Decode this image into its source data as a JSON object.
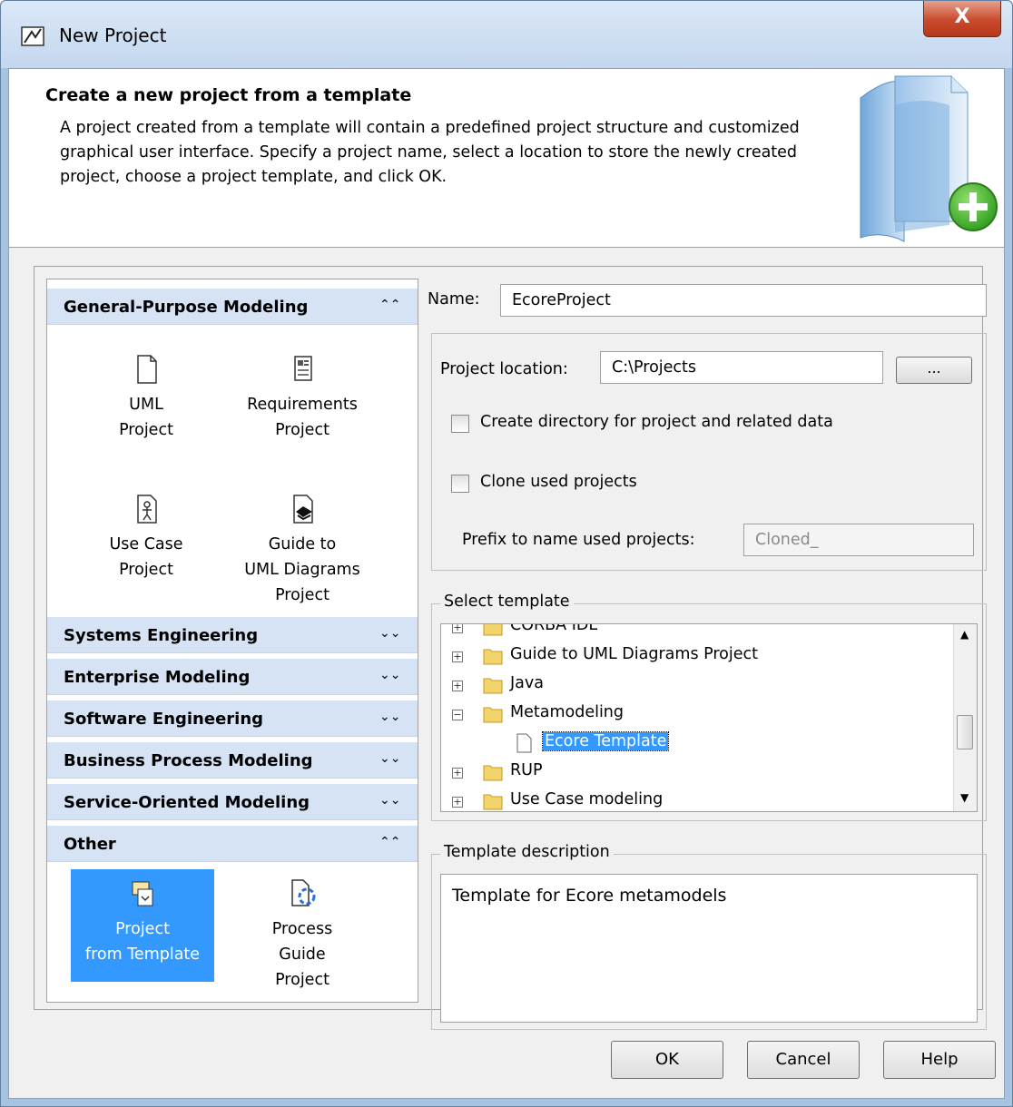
{
  "window": {
    "title": "New Project",
    "close_label": "X"
  },
  "header": {
    "title": "Create a new project from a template",
    "description": "A project created from a template will contain a predefined project structure and customized graphical user interface. Specify a project name, select a location to store the newly created project, choose a project template, and click OK."
  },
  "categories": {
    "general": {
      "label": "General-Purpose Modeling",
      "chevron": "⌃⌃",
      "tiles": [
        {
          "label1": "UML",
          "label2": "Project",
          "label3": ""
        },
        {
          "label1": "Requirements",
          "label2": "Project",
          "label3": ""
        },
        {
          "label1": "Use Case",
          "label2": "Project",
          "label3": ""
        },
        {
          "label1": "Guide to",
          "label2": "UML Diagrams",
          "label3": "Project"
        }
      ]
    },
    "systems": {
      "label": "Systems Engineering",
      "chevron": "⌄⌄"
    },
    "enterprise": {
      "label": "Enterprise Modeling",
      "chevron": "⌄⌄"
    },
    "software": {
      "label": "Software Engineering",
      "chevron": "⌄⌄"
    },
    "business": {
      "label": "Business Process Modeling",
      "chevron": "⌄⌄"
    },
    "service": {
      "label": "Service-Oriented Modeling",
      "chevron": "⌄⌄"
    },
    "other": {
      "label": "Other",
      "chevron": "⌃⌃",
      "tiles": [
        {
          "label1": "Project",
          "label2": "from Template",
          "label3": ""
        },
        {
          "label1": "Process",
          "label2": "Guide",
          "label3": "Project"
        }
      ]
    }
  },
  "form": {
    "name_label": "Name:",
    "name_value": "EcoreProject",
    "location_label": "Project location:",
    "location_value": "C:\\Projects",
    "browse_label": "...",
    "create_dir_label": "Create directory for project and related data",
    "clone_label": "Clone used projects",
    "prefix_label": "Prefix to name used projects:",
    "prefix_value": "Cloned_"
  },
  "template": {
    "legend": "Select template",
    "items": [
      {
        "label": "CORBA IDL"
      },
      {
        "label": "Guide to UML Diagrams Project"
      },
      {
        "label": "Java"
      },
      {
        "label": "Metamodeling"
      },
      {
        "label": "Ecore Template"
      },
      {
        "label": "RUP"
      },
      {
        "label": "Use Case modeling"
      }
    ]
  },
  "description": {
    "legend": "Template description",
    "text": "Template for Ecore metamodels"
  },
  "buttons": {
    "ok": "OK",
    "cancel": "Cancel",
    "help": "Help"
  }
}
